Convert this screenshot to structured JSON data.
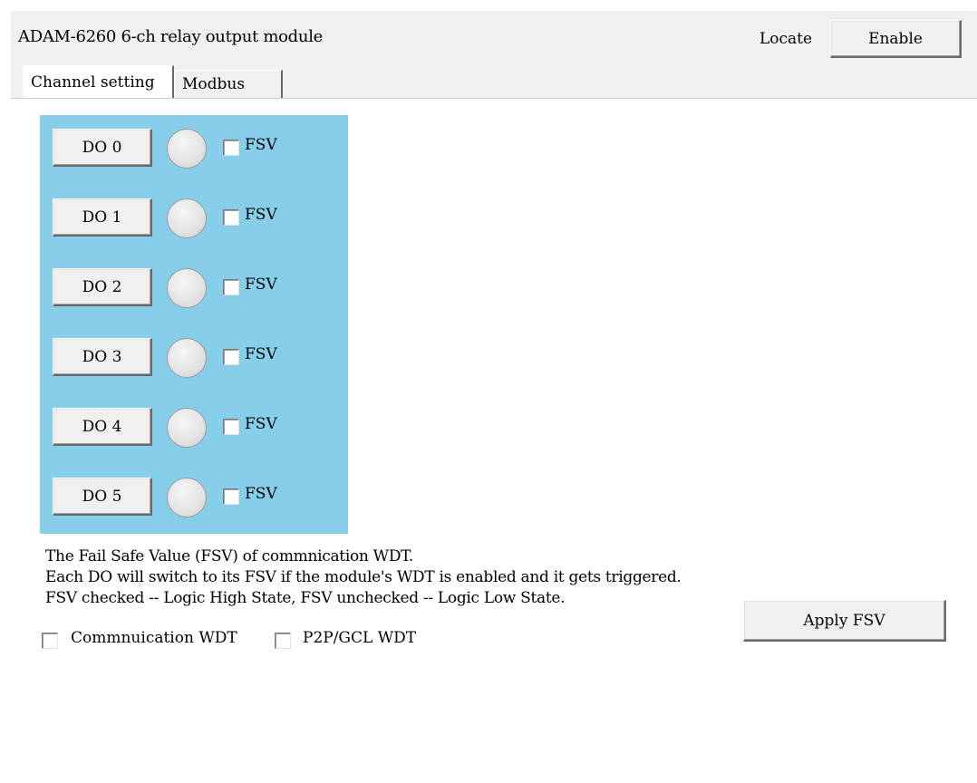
{
  "header": {
    "title": "ADAM-6260 6-ch relay output module",
    "locate_label": "Locate",
    "enable_label": "Enable"
  },
  "tabs": [
    {
      "label": "Channel setting",
      "active": true
    },
    {
      "label": "Modbus",
      "active": false
    }
  ],
  "channels": [
    {
      "label": "DO 0",
      "fsv_label": "FSV",
      "fsv_checked": false,
      "state": "off"
    },
    {
      "label": "DO 1",
      "fsv_label": "FSV",
      "fsv_checked": false,
      "state": "off"
    },
    {
      "label": "DO 2",
      "fsv_label": "FSV",
      "fsv_checked": false,
      "state": "off"
    },
    {
      "label": "DO 3",
      "fsv_label": "FSV",
      "fsv_checked": false,
      "state": "off"
    },
    {
      "label": "DO 4",
      "fsv_label": "FSV",
      "fsv_checked": false,
      "state": "off"
    },
    {
      "label": "DO 5",
      "fsv_label": "FSV",
      "fsv_checked": false,
      "state": "off"
    }
  ],
  "notes": [
    "The Fail Safe Value (FSV) of commnication WDT.",
    "Each DO will switch to its FSV if the module's WDT is enabled and it gets triggered.",
    "FSV checked -- Logic High State, FSV unchecked -- Logic Low State."
  ],
  "apply_fsv_label": "Apply FSV",
  "wdt_options": [
    {
      "label": "Commnuication WDT",
      "checked": false
    },
    {
      "label": "P2P/GCL WDT",
      "checked": false
    }
  ],
  "colors": {
    "channel_panel_bg": "#87ceeb",
    "window_bg": "#f0f0f0",
    "led_off": "#e4e4e4"
  }
}
